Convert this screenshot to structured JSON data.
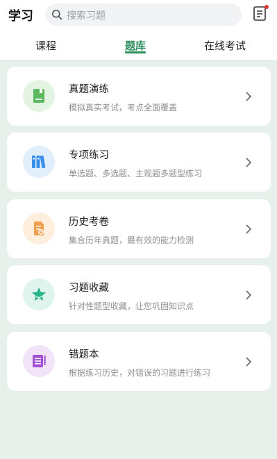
{
  "header": {
    "title": "学习",
    "search_placeholder": "搜索习题",
    "notification_dot_color": "#e53935"
  },
  "tabs": [
    {
      "label": "课程",
      "active": false
    },
    {
      "label": "题库",
      "active": true
    },
    {
      "label": "在线考试",
      "active": false
    }
  ],
  "theme": {
    "accent": "#2e8f5e",
    "background": "#e8f0ec"
  },
  "cards": [
    {
      "title": "真题演练",
      "desc": "模拟真实考试，考点全面覆盖",
      "icon": "book-icon",
      "icon_color": "#5cb85c",
      "icon_bg": "#e3f4e3"
    },
    {
      "title": "专项练习",
      "desc": "单选题、多选题、主观题多题型练习",
      "icon": "books-icon",
      "icon_color": "#3a8fe8",
      "icon_bg": "#e1eefb"
    },
    {
      "title": "历史考卷",
      "desc": "集合历年真题，最有效的能力检测",
      "icon": "exam-paper-icon",
      "icon_color": "#f0a04b",
      "icon_bg": "#fdeede"
    },
    {
      "title": "习题收藏",
      "desc": "针对性题型收藏，让您巩固知识点",
      "icon": "star-icon",
      "icon_color": "#29b48a",
      "icon_bg": "#def4ec"
    },
    {
      "title": "错题本",
      "desc": "根据练习历史，对错误的习题进行练习",
      "icon": "notebook-icon",
      "icon_color": "#a44fd6",
      "icon_bg": "#f1e4f8"
    }
  ]
}
